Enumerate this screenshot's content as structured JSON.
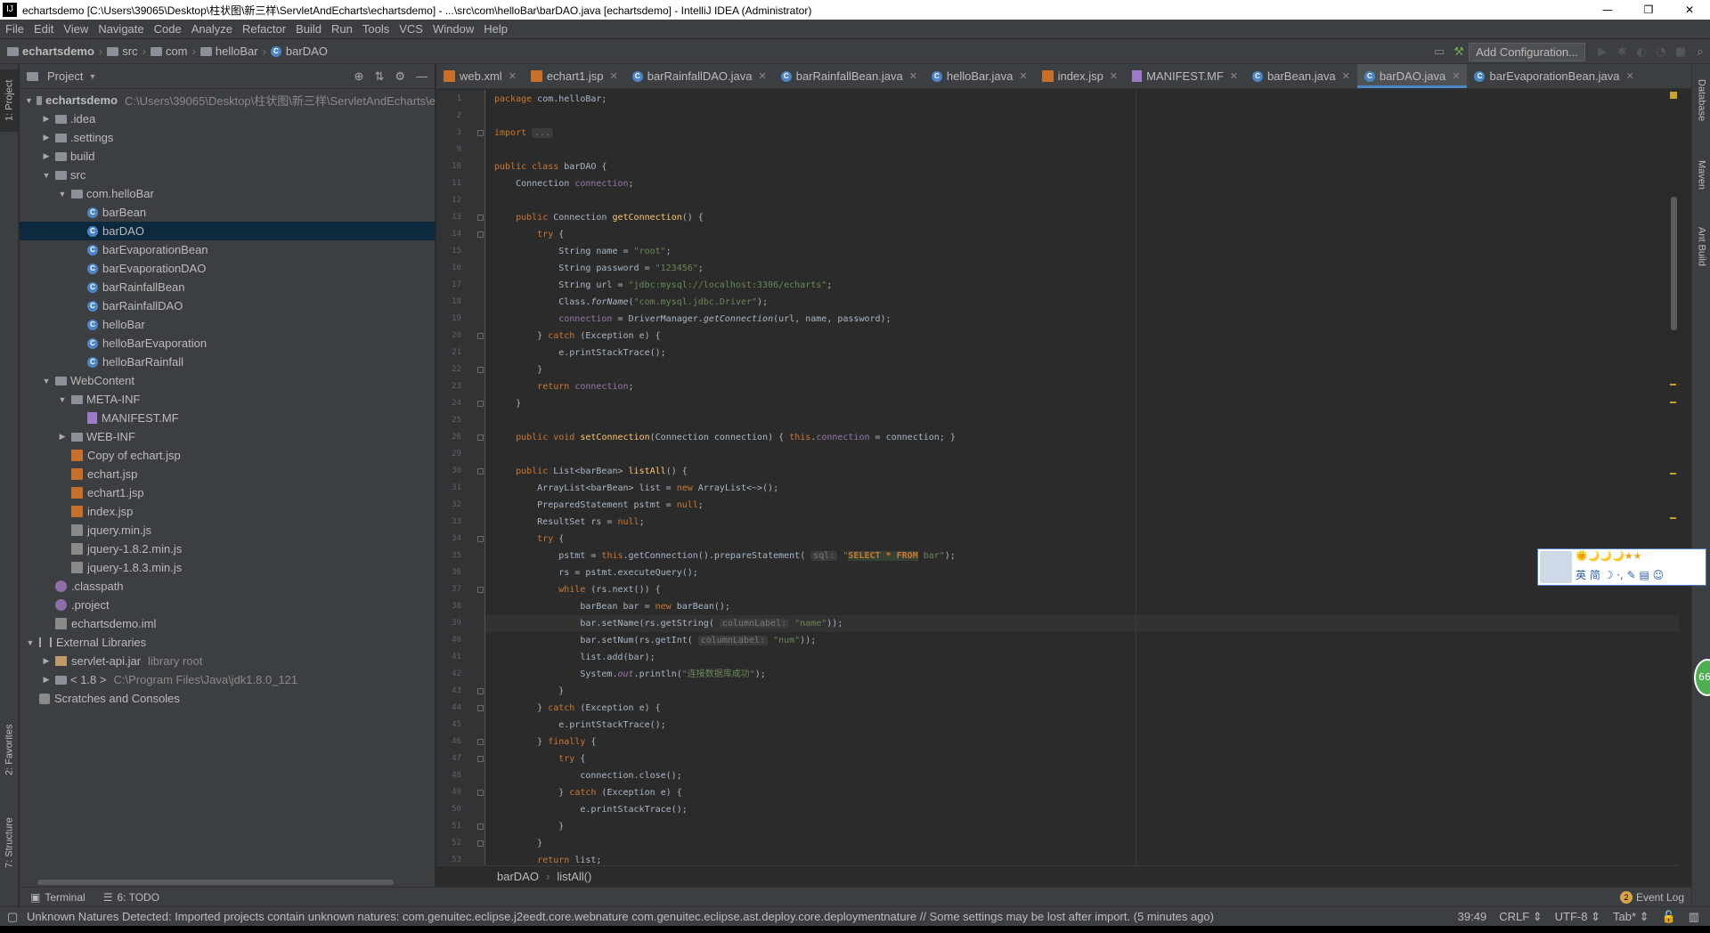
{
  "window": {
    "title": "echartsdemo [C:\\Users\\39065\\Desktop\\柱状图\\新三样\\ServletAndEcharts\\echartsdemo] - ...\\src\\com\\helloBar\\barDAO.java [echartsdemo] - IntelliJ IDEA (Administrator)",
    "minimize": "—",
    "maximize": "❐",
    "close": "✕"
  },
  "menu": [
    "File",
    "Edit",
    "View",
    "Navigate",
    "Code",
    "Analyze",
    "Refactor",
    "Build",
    "Run",
    "Tools",
    "VCS",
    "Window",
    "Help"
  ],
  "navbar": {
    "crumbs": [
      "echartsdemo",
      "src",
      "com",
      "helloBar",
      "barDAO"
    ],
    "add_configuration": "Add Configuration..."
  },
  "left_strip": {
    "project": "1: Project",
    "favorites": "2: Favorites",
    "structure": "7: Structure"
  },
  "right_strip": {
    "database": "Database",
    "maven": "Maven",
    "ant": "Ant Build"
  },
  "project_panel": {
    "title": "Project",
    "tree": [
      {
        "indent": 0,
        "arrow": "▼",
        "icon": "folder",
        "label": "echartsdemo",
        "path": "C:\\Users\\39065\\Desktop\\柱状图\\新三样\\ServletAndEcharts\\e",
        "bold": true
      },
      {
        "indent": 1,
        "arrow": "▶",
        "icon": "folder",
        "label": ".idea"
      },
      {
        "indent": 1,
        "arrow": "▶",
        "icon": "folder",
        "label": ".settings"
      },
      {
        "indent": 1,
        "arrow": "▶",
        "icon": "folder",
        "label": "build"
      },
      {
        "indent": 1,
        "arrow": "▼",
        "icon": "folder",
        "label": "src"
      },
      {
        "indent": 2,
        "arrow": "▼",
        "icon": "folder",
        "label": "com.helloBar"
      },
      {
        "indent": 3,
        "arrow": "",
        "icon": "class",
        "label": "barBean"
      },
      {
        "indent": 3,
        "arrow": "",
        "icon": "class",
        "label": "barDAO",
        "selected": true
      },
      {
        "indent": 3,
        "arrow": "",
        "icon": "class",
        "label": "barEvaporationBean"
      },
      {
        "indent": 3,
        "arrow": "",
        "icon": "class",
        "label": "barEvaporationDAO"
      },
      {
        "indent": 3,
        "arrow": "",
        "icon": "class",
        "label": "barRainfallBean"
      },
      {
        "indent": 3,
        "arrow": "",
        "icon": "class",
        "label": "barRainfallDAO"
      },
      {
        "indent": 3,
        "arrow": "",
        "icon": "class",
        "label": "helloBar"
      },
      {
        "indent": 3,
        "arrow": "",
        "icon": "class",
        "label": "helloBarEvaporation"
      },
      {
        "indent": 3,
        "arrow": "",
        "icon": "class",
        "label": "helloBarRainfall"
      },
      {
        "indent": 1,
        "arrow": "▼",
        "icon": "folder",
        "label": "WebContent"
      },
      {
        "indent": 2,
        "arrow": "▼",
        "icon": "folder",
        "label": "META-INF"
      },
      {
        "indent": 3,
        "arrow": "",
        "icon": "mf",
        "label": "MANIFEST.MF"
      },
      {
        "indent": 2,
        "arrow": "▶",
        "icon": "folder",
        "label": "WEB-INF"
      },
      {
        "indent": 2,
        "arrow": "",
        "icon": "jsp",
        "label": "Copy of echart.jsp"
      },
      {
        "indent": 2,
        "arrow": "",
        "icon": "jsp",
        "label": "echart.jsp"
      },
      {
        "indent": 2,
        "arrow": "",
        "icon": "jsp",
        "label": "echart1.jsp"
      },
      {
        "indent": 2,
        "arrow": "",
        "icon": "jsp",
        "label": "index.jsp"
      },
      {
        "indent": 2,
        "arrow": "",
        "icon": "js",
        "label": "jquery.min.js"
      },
      {
        "indent": 2,
        "arrow": "",
        "icon": "js",
        "label": "jquery-1.8.2.min.js"
      },
      {
        "indent": 2,
        "arrow": "",
        "icon": "js",
        "label": "jquery-1.8.3.min.js"
      },
      {
        "indent": 1,
        "arrow": "",
        "icon": "cp",
        "label": ".classpath"
      },
      {
        "indent": 1,
        "arrow": "",
        "icon": "cp",
        "label": ".project"
      },
      {
        "indent": 1,
        "arrow": "",
        "icon": "iml",
        "label": "echartsdemo.iml"
      },
      {
        "indent": 0,
        "arrow": "▼",
        "icon": "lib",
        "label": "External Libraries"
      },
      {
        "indent": 1,
        "arrow": "▶",
        "icon": "jar",
        "label": "servlet-api.jar",
        "path": "library root"
      },
      {
        "indent": 1,
        "arrow": "▶",
        "icon": "jdk",
        "label": "< 1.8 >",
        "path": "C:\\Program Files\\Java\\jdk1.8.0_121"
      },
      {
        "indent": 0,
        "arrow": "",
        "icon": "scratch",
        "label": "Scratches and Consoles"
      }
    ]
  },
  "tabs": [
    {
      "label": "web.xml",
      "icon": "xml"
    },
    {
      "label": "echart1.jsp",
      "icon": "jsp"
    },
    {
      "label": "barRainfallDAO.java",
      "icon": "class"
    },
    {
      "label": "barRainfallBean.java",
      "icon": "class"
    },
    {
      "label": "helloBar.java",
      "icon": "class"
    },
    {
      "label": "index.jsp",
      "icon": "jsp"
    },
    {
      "label": "MANIFEST.MF",
      "icon": "mf"
    },
    {
      "label": "barBean.java",
      "icon": "class"
    },
    {
      "label": "barDAO.java",
      "icon": "class",
      "active": true
    },
    {
      "label": "barEvaporationBean.java",
      "icon": "class"
    }
  ],
  "code": {
    "current_line": 39,
    "lines": [
      {
        "n": "1",
        "fold": false,
        "html": "<span class='kw'>package</span> com.helloBar;"
      },
      {
        "n": "2",
        "fold": false,
        "html": ""
      },
      {
        "n": "3",
        "fold": true,
        "html": "<span class='kw'>import</span> <span class='hint'>...</span>"
      },
      {
        "n": "9",
        "fold": false,
        "html": ""
      },
      {
        "n": "10",
        "fold": false,
        "html": "<span class='kw'>public class</span> barDAO {"
      },
      {
        "n": "11",
        "fold": false,
        "html": "    Connection <span class='fld'>connection</span>;"
      },
      {
        "n": "12",
        "fold": false,
        "html": ""
      },
      {
        "n": "13",
        "fold": true,
        "html": "    <span class='kw'>public</span> Connection <span class='fn'>getConnection</span>() {"
      },
      {
        "n": "14",
        "fold": true,
        "html": "        <span class='kw'>try</span> {"
      },
      {
        "n": "15",
        "fold": false,
        "html": "            String name = <span class='str'>\"root\"</span>;"
      },
      {
        "n": "16",
        "fold": false,
        "html": "            String password = <span class='str'>\"123456\"</span>;"
      },
      {
        "n": "17",
        "fold": false,
        "html": "            String url = <span class='str'>\"jdbc:mysql://localhost:3306/echarts\"</span>;"
      },
      {
        "n": "18",
        "fold": false,
        "html": "            Class.<i>forName</i>(<span class='str'>\"com.mysql.jdbc.Driver\"</span>);"
      },
      {
        "n": "19",
        "fold": false,
        "html": "            <span class='fld'>connection</span> = DriverManager.<i>getConnection</i>(url, name, password);"
      },
      {
        "n": "20",
        "fold": true,
        "html": "        } <span class='kw'>catch</span> (Exception e) {"
      },
      {
        "n": "21",
        "fold": false,
        "html": "            e.printStackTrace();"
      },
      {
        "n": "22",
        "fold": true,
        "html": "        }"
      },
      {
        "n": "23",
        "fold": false,
        "html": "        <span class='kw'>return</span> <span class='fld'>connection</span>;"
      },
      {
        "n": "24",
        "fold": true,
        "html": "    }"
      },
      {
        "n": "25",
        "fold": false,
        "html": ""
      },
      {
        "n": "26",
        "fold": true,
        "html": "    <span class='kw'>public void</span> <span class='fn'>setConnection</span>(Connection connection) { <span class='kw'>this</span>.<span class='fld'>connection</span> = connection; }"
      },
      {
        "n": "29",
        "fold": false,
        "html": ""
      },
      {
        "n": "30",
        "fold": true,
        "html": "    <span class='kw'>public</span> List&lt;barBean&gt; <span class='fn'>listAll</span>() {"
      },
      {
        "n": "31",
        "fold": false,
        "html": "        ArrayList&lt;barBean&gt; list = <span class='kw'>new</span> ArrayList&lt;~&gt;();"
      },
      {
        "n": "32",
        "fold": false,
        "html": "        PreparedStatement pstmt = <span class='kw'>null</span>;"
      },
      {
        "n": "33",
        "fold": false,
        "html": "        ResultSet rs = <span class='kw'>null</span>;"
      },
      {
        "n": "34",
        "fold": true,
        "html": "        <span class='kw'>try</span> {"
      },
      {
        "n": "35",
        "fold": false,
        "html": "            pstmt = <span class='kw'>this</span>.getConnection().prepareStatement( <span class='hint'>sql:</span> <span class='str'>\"<b style='color:#cc7832;background:#364135'>SELECT * FROM</b> bar\"</span>);"
      },
      {
        "n": "36",
        "fold": false,
        "html": "            rs = pstmt.executeQuery();"
      },
      {
        "n": "37",
        "fold": true,
        "html": "            <span class='kw'>while</span> (rs.next()) {"
      },
      {
        "n": "38",
        "fold": false,
        "html": "                barBean bar = <span class='kw'>new</span> barBean();"
      },
      {
        "n": "39",
        "fold": false,
        "html": "                bar.setName(rs.getString( <span class='hint'>columnLabel:</span> <span class='str'>\"name\"</span>));"
      },
      {
        "n": "40",
        "fold": false,
        "html": "                bar.setNum(rs.getInt( <span class='hint'>columnLabel:</span> <span class='str'>\"num\"</span>));"
      },
      {
        "n": "41",
        "fold": false,
        "html": "                list.add(bar);"
      },
      {
        "n": "42",
        "fold": false,
        "html": "                System.<span class='fld'><i>out</i></span>.println(<span class='str'>\"连接数据库成功\"</span>);"
      },
      {
        "n": "43",
        "fold": true,
        "html": "            }"
      },
      {
        "n": "44",
        "fold": true,
        "html": "        } <span class='kw'>catch</span> (Exception e) {"
      },
      {
        "n": "45",
        "fold": false,
        "html": "            e.printStackTrace();"
      },
      {
        "n": "46",
        "fold": true,
        "html": "        } <span class='kw'>finally</span> {"
      },
      {
        "n": "47",
        "fold": true,
        "html": "            <span class='kw'>try</span> {"
      },
      {
        "n": "48",
        "fold": false,
        "html": "                connection.close();"
      },
      {
        "n": "49",
        "fold": true,
        "html": "            } <span class='kw'>catch</span> (Exception e) {"
      },
      {
        "n": "50",
        "fold": false,
        "html": "                e.printStackTrace();"
      },
      {
        "n": "51",
        "fold": true,
        "html": "            }"
      },
      {
        "n": "52",
        "fold": true,
        "html": "        }"
      },
      {
        "n": "53",
        "fold": false,
        "html": "        <span class='kw'>return</span> list;"
      }
    ]
  },
  "editor_breadcrumb": [
    "barDAO",
    "listAll()"
  ],
  "tool_windows": {
    "terminal": "Terminal",
    "todo": "6: TODO",
    "event_log": "Event Log",
    "event_count": "2"
  },
  "status": {
    "message": "Unknown Natures Detected: Imported projects contain unknown natures: com.genuitec.eclipse.j2eedt.core.webnature com.genuitec.eclipse.ast.deploy.core.deploymentnature // Some settings may be lost after import. (5 minutes ago)",
    "position": "39:49",
    "line_sep": "CRLF ⇕",
    "encoding": "UTF-8 ⇕",
    "indent": "Tab* ⇕"
  },
  "ime": {
    "stars": "🌞🌙🌙🌙★★",
    "text": "英 简 ☽ ·, ✎ ▤ ☺"
  },
  "bubble": "66",
  "colors": {
    "accent": "#4a88c7",
    "keyword": "#cc7832",
    "string": "#6a8759",
    "field": "#9876aa",
    "method": "#ffc66d",
    "selection": "#0d293e"
  }
}
